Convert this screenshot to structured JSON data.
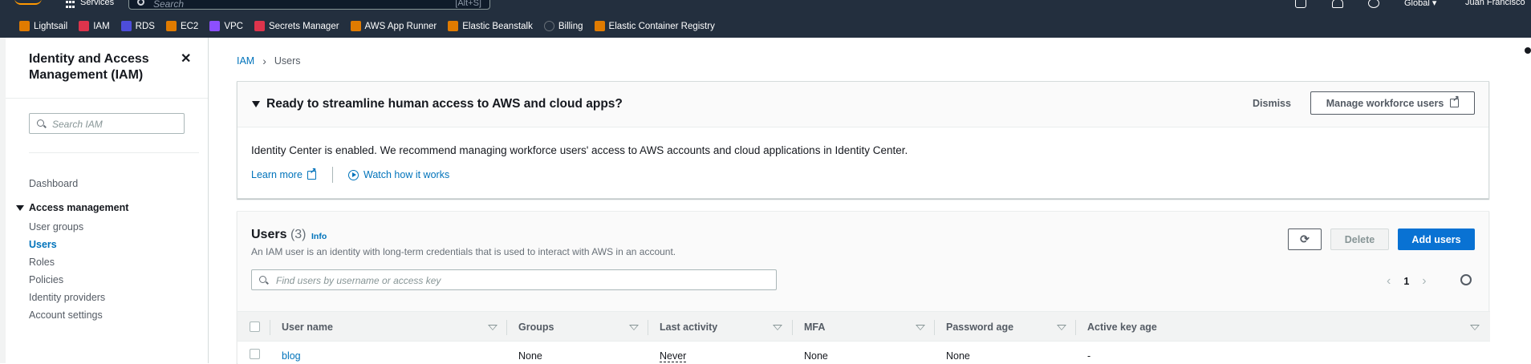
{
  "topnav": {
    "services_label": "Services",
    "search_placeholder": "Search",
    "search_shortcut": "[Alt+S]",
    "region": "Global ▾",
    "user": "Juan Francisco"
  },
  "favorites": [
    {
      "label": "Lightsail",
      "color": "#e07b00"
    },
    {
      "label": "IAM",
      "color": "#dd344c"
    },
    {
      "label": "RDS",
      "color": "#4d4ddb"
    },
    {
      "label": "EC2",
      "color": "#e07b00"
    },
    {
      "label": "VPC",
      "color": "#8c4fff"
    },
    {
      "label": "Secrets Manager",
      "color": "#dd344c"
    },
    {
      "label": "AWS App Runner",
      "color": "#e07b00"
    },
    {
      "label": "Elastic Beanstalk",
      "color": "#e07b00"
    },
    {
      "label": "Billing",
      "color": "#232f3e"
    },
    {
      "label": "Elastic Container Registry",
      "color": "#e07b00"
    }
  ],
  "sidebar": {
    "title": "Identity and Access Management (IAM)",
    "search_placeholder": "Search IAM",
    "dashboard": "Dashboard",
    "section": "Access management",
    "items": [
      "User groups",
      "Users",
      "Roles",
      "Policies",
      "Identity providers",
      "Account settings"
    ]
  },
  "breadcrumb": {
    "root": "IAM",
    "current": "Users"
  },
  "banner": {
    "title": "Ready to streamline human access to AWS and cloud apps?",
    "dismiss": "Dismiss",
    "manage": "Manage workforce users",
    "body": "Identity Center is enabled. We recommend managing workforce users' access to AWS accounts and cloud applications in Identity Center.",
    "learn_more": "Learn more",
    "watch": "Watch how it works"
  },
  "users_panel": {
    "title": "Users",
    "count": "(3)",
    "info": "Info",
    "description": "An IAM user is an identity with long-term credentials that is used to interact with AWS in an account.",
    "delete": "Delete",
    "add": "Add users",
    "filter_placeholder": "Find users by username or access key",
    "page": "1",
    "columns": [
      "User name",
      "Groups",
      "Last activity",
      "MFA",
      "Password age",
      "Active key age"
    ],
    "rows": [
      {
        "user_name": "blog",
        "groups": "None",
        "last_activity": "Never",
        "mfa": "None",
        "password_age": "None",
        "active_key_age": "-"
      }
    ]
  }
}
